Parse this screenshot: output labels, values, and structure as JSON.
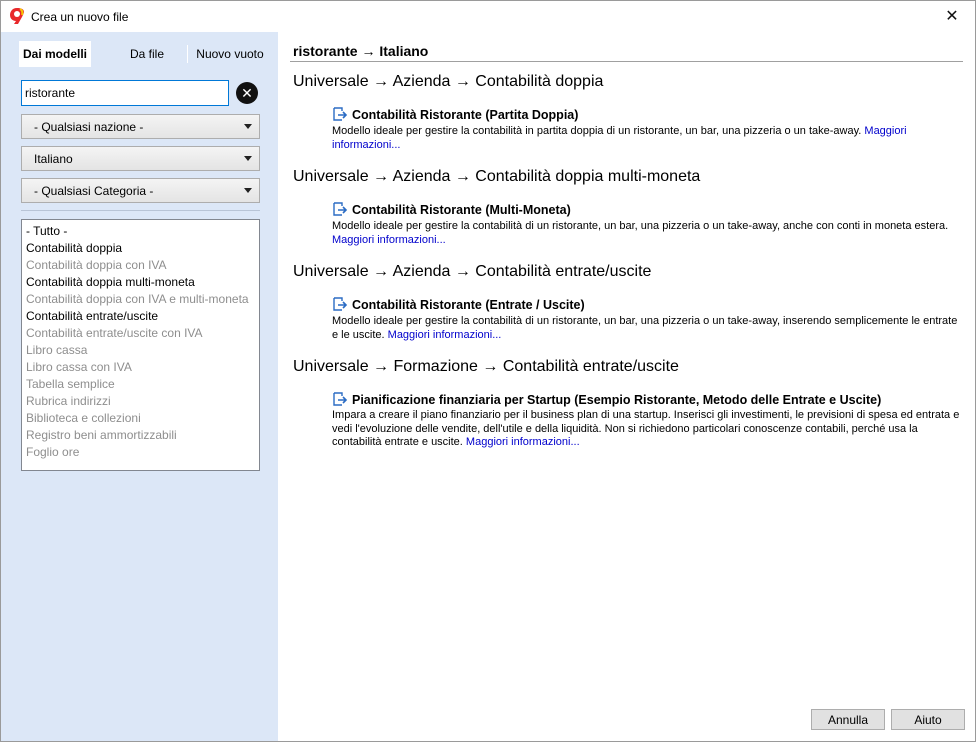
{
  "window": {
    "title": "Crea un nuovo file",
    "close_label": "✕"
  },
  "tabs": [
    {
      "label": "Dai modelli",
      "active": true
    },
    {
      "label": "Da file",
      "active": false
    },
    {
      "label": "Nuovo vuoto",
      "active": false
    }
  ],
  "search": {
    "value": "ristorante",
    "placeholder": ""
  },
  "filters": {
    "nation": "- Qualsiasi nazione -",
    "language": "Italiano",
    "category": "- Qualsiasi Categoria -"
  },
  "categories": [
    {
      "label": "- Tutto -",
      "enabled": true
    },
    {
      "label": "Contabilità doppia",
      "enabled": true
    },
    {
      "label": "Contabilità doppia con IVA",
      "enabled": false
    },
    {
      "label": "Contabilità doppia multi-moneta",
      "enabled": true
    },
    {
      "label": "Contabilità doppia con IVA e multi-moneta",
      "enabled": false
    },
    {
      "label": "Contabilità entrate/uscite",
      "enabled": true
    },
    {
      "label": "Contabilità entrate/uscite con IVA",
      "enabled": false
    },
    {
      "label": "Libro cassa",
      "enabled": false
    },
    {
      "label": "Libro cassa con IVA",
      "enabled": false
    },
    {
      "label": "Tabella semplice",
      "enabled": false
    },
    {
      "label": "Rubrica indirizzi",
      "enabled": false
    },
    {
      "label": "Biblioteca e collezioni",
      "enabled": false
    },
    {
      "label": "Registro beni ammortizzabili",
      "enabled": false
    },
    {
      "label": "Foglio ore",
      "enabled": false
    }
  ],
  "results": {
    "header": "ristorante → Italiano",
    "groups": [
      {
        "title": "Universale → Azienda → Contabilità doppia",
        "template": {
          "title": "Contabilità Ristorante (Partita Doppia)",
          "description": "Modello ideale per gestire la contabilità in partita doppia di un ristorante, un bar, una pizzeria o un take-away.",
          "link": "Maggiori informazioni..."
        }
      },
      {
        "title": "Universale → Azienda → Contabilità doppia multi-moneta",
        "template": {
          "title": "Contabilità Ristorante (Multi-Moneta)",
          "description": "Modello ideale per gestire la contabilità di un ristorante, un bar, una pizzeria o un take-away, anche con conti in moneta estera.",
          "link": "Maggiori informazioni..."
        }
      },
      {
        "title": "Universale → Azienda → Contabilità entrate/uscite",
        "template": {
          "title": "Contabilità Ristorante (Entrate / Uscite)",
          "description": "Modello ideale per gestire la contabilità di un ristorante, un bar, una pizzeria o un take-away, inserendo semplicemente le entrate e le uscite.",
          "link": "Maggiori informazioni..."
        }
      },
      {
        "title": "Universale → Formazione → Contabilità entrate/uscite",
        "template": {
          "title": "Pianificazione finanziaria per Startup (Esempio Ristorante, Metodo delle Entrate e Uscite)",
          "description": "Impara a creare il piano finanziario per il business plan di una startup. Inserisci gli investimenti, le previsioni di spesa ed entrata e vedi l'evoluzione delle vendite, dell'utile e della liquidità. Non si richiedono particolari conoscenze contabili, perché usa la contabilità entrate e uscite.",
          "link": "Maggiori informazioni..."
        }
      }
    ]
  },
  "buttons": {
    "cancel": "Annulla",
    "help": "Aiuto"
  },
  "colors": {
    "left_panel": "#dce7f7",
    "link": "#0000cc",
    "accent": "#0078d7"
  },
  "icons": {
    "app": "banana-logo-icon",
    "template": "template-arrow-icon"
  }
}
